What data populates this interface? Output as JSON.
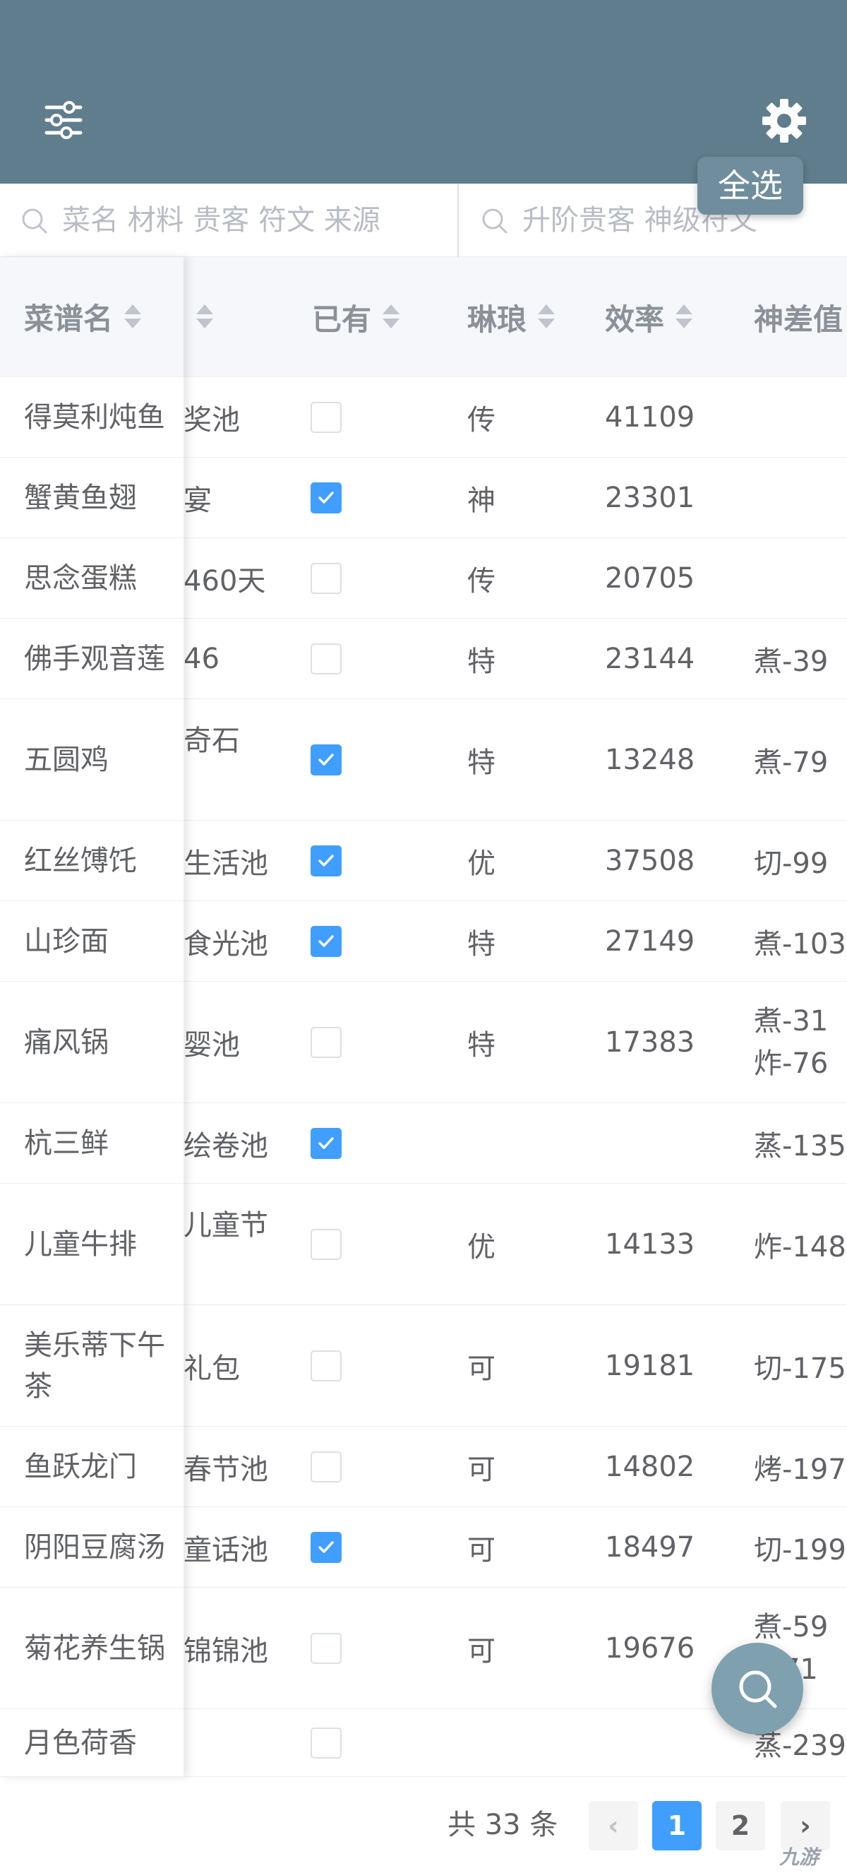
{
  "header": {
    "select_all_label": "全选"
  },
  "search": {
    "left_placeholder": "菜名 材料 贵客 符文 来源",
    "right_placeholder": "升阶贵客 神级符文"
  },
  "columns": {
    "name": "菜谱名",
    "owned": "已有",
    "rarity": "琳琅",
    "efficiency": "效率",
    "god_diff": "神差值"
  },
  "rows": [
    {
      "name": "得莫利炖鱼",
      "source": "奖池",
      "owned": false,
      "rarity": "传",
      "efficiency": "41109",
      "god_diff": ""
    },
    {
      "name": "蟹黄鱼翅",
      "source": "宴",
      "owned": true,
      "rarity": "神",
      "efficiency": "23301",
      "god_diff": ""
    },
    {
      "name": "思念蛋糕",
      "source": "460天",
      "owned": false,
      "rarity": "传",
      "efficiency": "20705",
      "god_diff": ""
    },
    {
      "name": "佛手观音莲",
      "source": "46",
      "owned": false,
      "rarity": "特",
      "efficiency": "23144",
      "god_diff": "煮-39"
    },
    {
      "name": "五圆鸡",
      "source": "奇石",
      "owned": true,
      "rarity": "特",
      "efficiency": "13248",
      "god_diff": "煮-79"
    },
    {
      "name": "红丝馎饦",
      "source": "生活池",
      "owned": true,
      "rarity": "优",
      "efficiency": "37508",
      "god_diff": "切-99"
    },
    {
      "name": "山珍面",
      "source": "食光池",
      "owned": true,
      "rarity": "特",
      "efficiency": "27149",
      "god_diff": "煮-103"
    },
    {
      "name": "痛风锅",
      "source": "婴池",
      "owned": false,
      "rarity": "特",
      "efficiency": "17383",
      "god_diff": "煮-31 炸-76"
    },
    {
      "name": "杭三鲜",
      "source": "绘卷池",
      "owned": true,
      "rarity": "",
      "efficiency": "",
      "god_diff": "蒸-135"
    },
    {
      "name": "儿童牛排",
      "source": "儿童节",
      "owned": false,
      "rarity": "优",
      "efficiency": "14133",
      "god_diff": "炸-148"
    },
    {
      "name": "美乐蒂下午茶",
      "source": "礼包",
      "owned": false,
      "rarity": "可",
      "efficiency": "19181",
      "god_diff": "切-175"
    },
    {
      "name": "鱼跃龙门",
      "source": "春节池",
      "owned": false,
      "rarity": "可",
      "efficiency": "14802",
      "god_diff": "烤-197"
    },
    {
      "name": "阴阳豆腐汤",
      "source": "童话池",
      "owned": true,
      "rarity": "可",
      "efficiency": "18497",
      "god_diff": "切-199"
    },
    {
      "name": "菊花养生锅",
      "source": "锦锦池",
      "owned": false,
      "rarity": "可",
      "efficiency": "19676",
      "god_diff": "煮-59 -171"
    },
    {
      "name": "月色荷香",
      "source": "",
      "owned": false,
      "rarity": "",
      "efficiency": "",
      "god_diff": "蒸-239"
    }
  ],
  "pagination": {
    "total_label": "共 33 条",
    "prev": "‹",
    "page1": "1",
    "page2": "2",
    "next": "›",
    "current_page": 1
  },
  "watermark": "九游",
  "colors": {
    "header_bg": "#5f7d8c",
    "accent": "#409eff",
    "fab_bg": "#7fa0af"
  }
}
